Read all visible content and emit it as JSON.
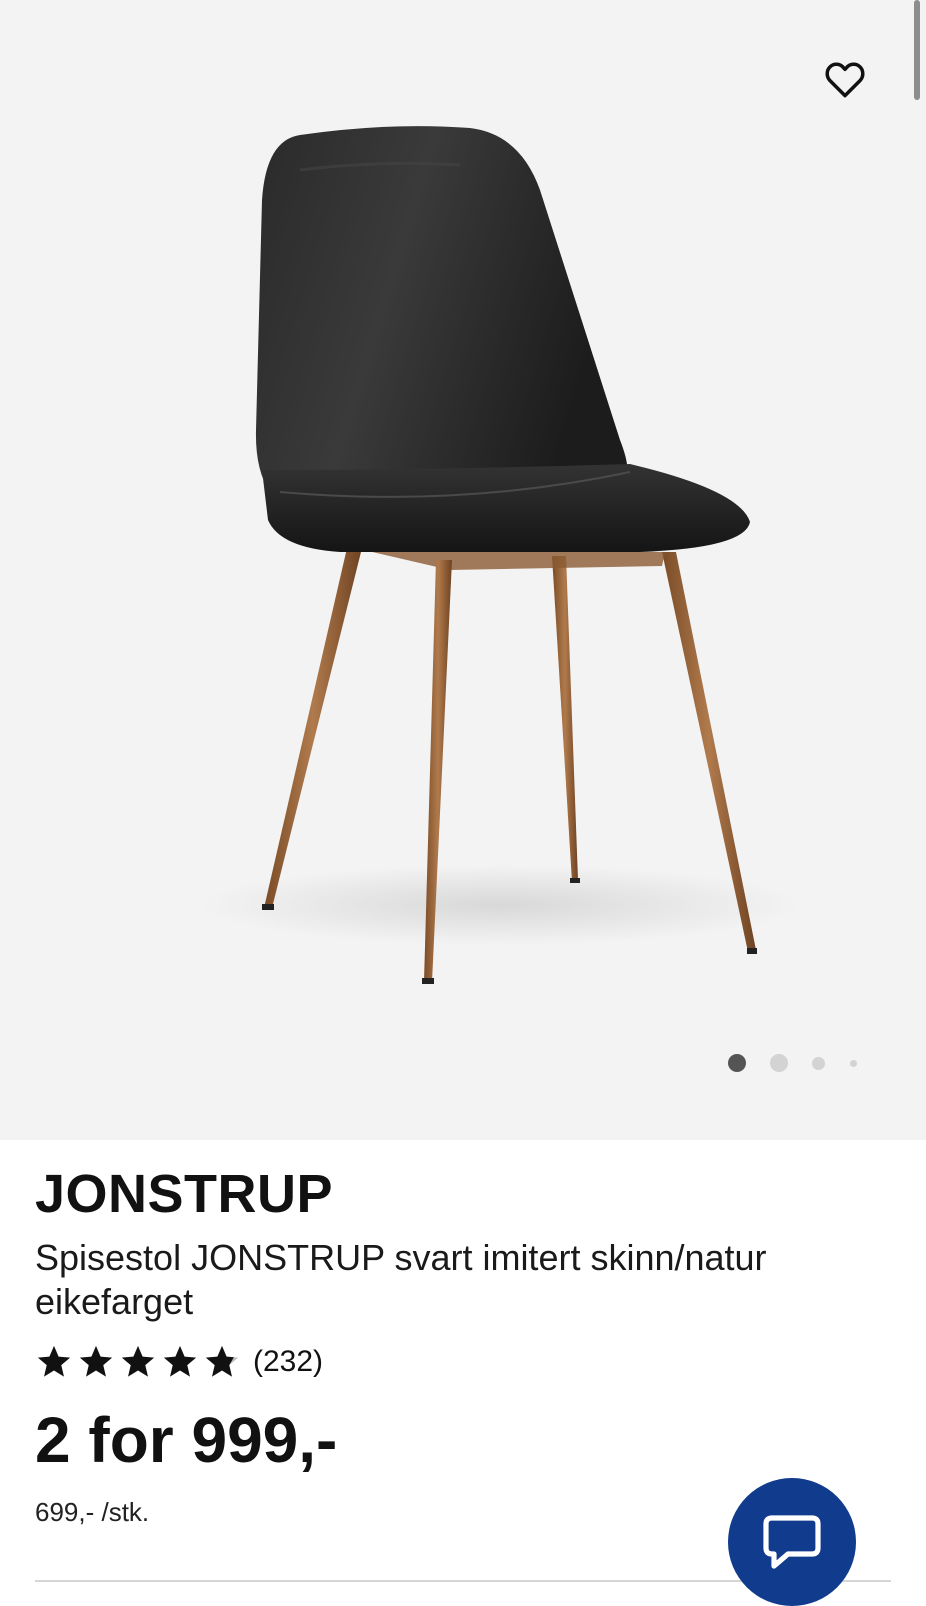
{
  "product": {
    "brand": "JONSTRUP",
    "description": "Spisestol JONSTRUP svart imitert skinn/natur eikefarget",
    "rating": {
      "stars": 4.7,
      "max": 5,
      "count_label": "(232)"
    },
    "price_label": "2 for 999,-",
    "unit_price_label": "699,- /stk."
  },
  "gallery": {
    "image_count": 4,
    "active_index": 0
  },
  "colors": {
    "accent": "#113b8d",
    "gallery_bg": "#f3f3f3",
    "dot_active": "#555555",
    "dot_inactive": "#d3d3d3"
  },
  "icons": {
    "favorite": "heart-outline-icon",
    "chat": "chat-bubble-icon",
    "star": "star-icon"
  }
}
